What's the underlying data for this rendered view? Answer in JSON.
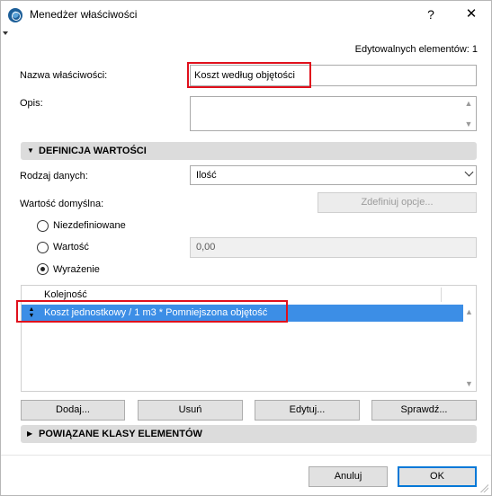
{
  "window": {
    "title": "Menedżer właściwości",
    "help_glyph": "?",
    "close_glyph": "✕"
  },
  "editable_count": "Edytowalnych elementów: 1",
  "property": {
    "name_label": "Nazwa właściwości:",
    "name_value": "Koszt według objętości",
    "description_label": "Opis:",
    "description_value": ""
  },
  "value_definition": {
    "section_title": "DEFINICJA WARTOŚCI",
    "data_type_label": "Rodzaj danych:",
    "data_type_value": "Ilość",
    "default_value_label": "Wartość domyślna:",
    "define_options_button": "Zdefiniuj opcje...",
    "options": [
      {
        "label": "Niezdefiniowane",
        "selected": false
      },
      {
        "label": "Wartość",
        "selected": false
      },
      {
        "label": "Wyrażenie",
        "selected": true
      }
    ],
    "value_field": "0,00"
  },
  "expression_list": {
    "column_header": "Kolejność",
    "rows": [
      {
        "text": "Koszt jednostkowy / 1 m3 * Pomniejszona objętość",
        "selected": true
      }
    ]
  },
  "list_buttons": {
    "add": "Dodaj...",
    "remove": "Usuń",
    "edit": "Edytuj...",
    "check": "Sprawdź..."
  },
  "linked_classes": {
    "section_title": "POWIĄZANE KLASY ELEMENTÓW"
  },
  "footer": {
    "cancel": "Anuluj",
    "ok": "OK"
  },
  "colors": {
    "selection": "#3c8ee6",
    "highlight_box": "#e0101c",
    "section_bar": "#dcdcdc"
  }
}
